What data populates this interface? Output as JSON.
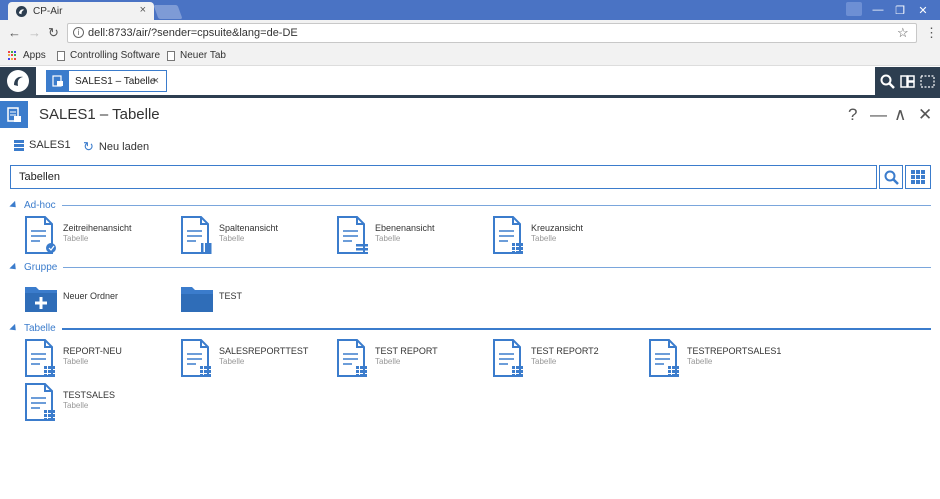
{
  "browser": {
    "tab_title": "CP-Air",
    "tab_close": "×",
    "url": "dell:8733/air/?sender=cpsuite&lang=de-DE",
    "bookmarks": [
      "Apps",
      "Controlling Software",
      "Neuer Tab"
    ],
    "win_min": "—",
    "win_max": "❐",
    "win_close": "✕"
  },
  "app": {
    "doc_tab_label": "SALES1 – Tabelle",
    "doc_tab_close": "×",
    "panel_title": "SALES1 – Tabelle",
    "panel_controls": [
      "?",
      "—",
      "∧",
      "✕"
    ]
  },
  "toolbar": {
    "db_label": "SALES1",
    "reload_label": "Neu laden"
  },
  "search": {
    "value": "Tabellen"
  },
  "sections": {
    "adhoc": {
      "label": "Ad-hoc",
      "items": [
        {
          "name": "Zeitreihenansicht",
          "sub": "Tabelle"
        },
        {
          "name": "Spaltenansicht",
          "sub": "Tabelle"
        },
        {
          "name": "Ebenenansicht",
          "sub": "Tabelle"
        },
        {
          "name": "Kreuzansicht",
          "sub": "Tabelle"
        }
      ]
    },
    "gruppe": {
      "label": "Gruppe",
      "items": [
        {
          "name": "Neuer Ordner"
        },
        {
          "name": "TEST"
        }
      ]
    },
    "tabelle": {
      "label": "Tabelle",
      "items": [
        {
          "name": "REPORT-NEU",
          "sub": "Tabelle"
        },
        {
          "name": "SALESREPORTTEST",
          "sub": "Tabelle"
        },
        {
          "name": "TEST REPORT",
          "sub": "Tabelle"
        },
        {
          "name": "TEST REPORT2",
          "sub": "Tabelle"
        },
        {
          "name": "TESTREPORTSALES1",
          "sub": "Tabelle"
        },
        {
          "name": "TESTSALES",
          "sub": "Tabelle"
        }
      ]
    }
  },
  "colors": {
    "accent": "#3b7ccc",
    "dark": "#2d3e50",
    "chrome": "#4a73c4"
  }
}
